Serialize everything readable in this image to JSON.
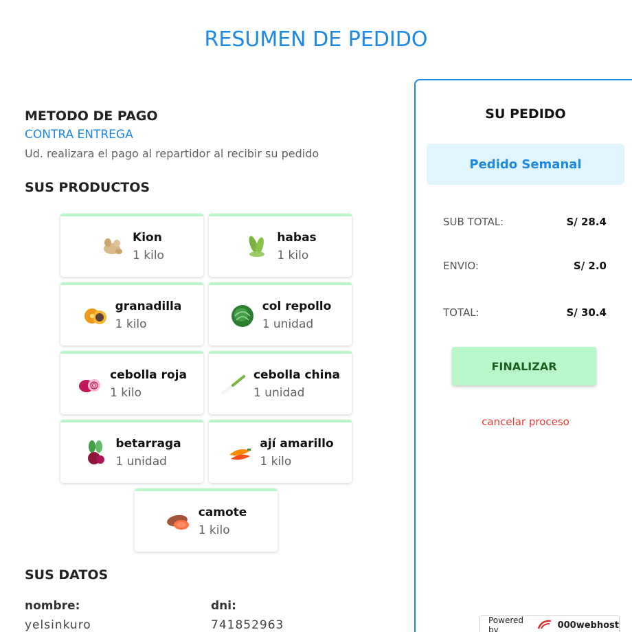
{
  "page": {
    "title": "RESUMEN DE PEDIDO"
  },
  "payment": {
    "section_title": "METODO DE PAGO",
    "method": "CONTRA ENTREGA",
    "note": "Ud. realizara el pago al repartidor al recibir su pedido"
  },
  "products": {
    "section_title": "SUS PRODUCTOS",
    "items": [
      {
        "name": "Kion",
        "qty": "1 kilo",
        "icon": "ginger-icon"
      },
      {
        "name": "habas",
        "qty": "1 kilo",
        "icon": "fava-beans-icon"
      },
      {
        "name": "granadilla",
        "qty": "1 kilo",
        "icon": "granadilla-icon"
      },
      {
        "name": "col repollo",
        "qty": "1 unidad",
        "icon": "cabbage-icon"
      },
      {
        "name": "cebolla roja",
        "qty": "1 kilo",
        "icon": "red-onion-icon"
      },
      {
        "name": "cebolla china",
        "qty": "1 unidad",
        "icon": "spring-onion-icon"
      },
      {
        "name": "betarraga",
        "qty": "1 unidad",
        "icon": "beet-icon"
      },
      {
        "name": "ají amarillo",
        "qty": "1 kilo",
        "icon": "yellow-pepper-icon"
      },
      {
        "name": "camote",
        "qty": "1 kilo",
        "icon": "sweet-potato-icon"
      }
    ]
  },
  "user_data": {
    "section_title": "SUS DATOS",
    "name_label": "nombre:",
    "name_value": "yelsinkuro",
    "dni_label": "dni:",
    "dni_value": "741852963"
  },
  "order": {
    "title": "SU PEDIDO",
    "plan": "Pedido Semanal",
    "subtotal_label": "SUB TOTAL:",
    "subtotal_value": "S/ 28.4",
    "shipping_label": "ENVIO:",
    "shipping_value": "S/ 2.0",
    "total_label": "TOTAL:",
    "total_value": "S/ 30.4",
    "finalize_label": "FINALIZAR",
    "cancel_label": "cancelar proceso"
  },
  "footer": {
    "powered_by": "Powered by",
    "brand": "000webhost"
  },
  "colors": {
    "accent": "#1e88e5",
    "success_bg": "#b9f6ca",
    "cancel": "#e53935",
    "plan_bg": "#e1f5fe"
  }
}
